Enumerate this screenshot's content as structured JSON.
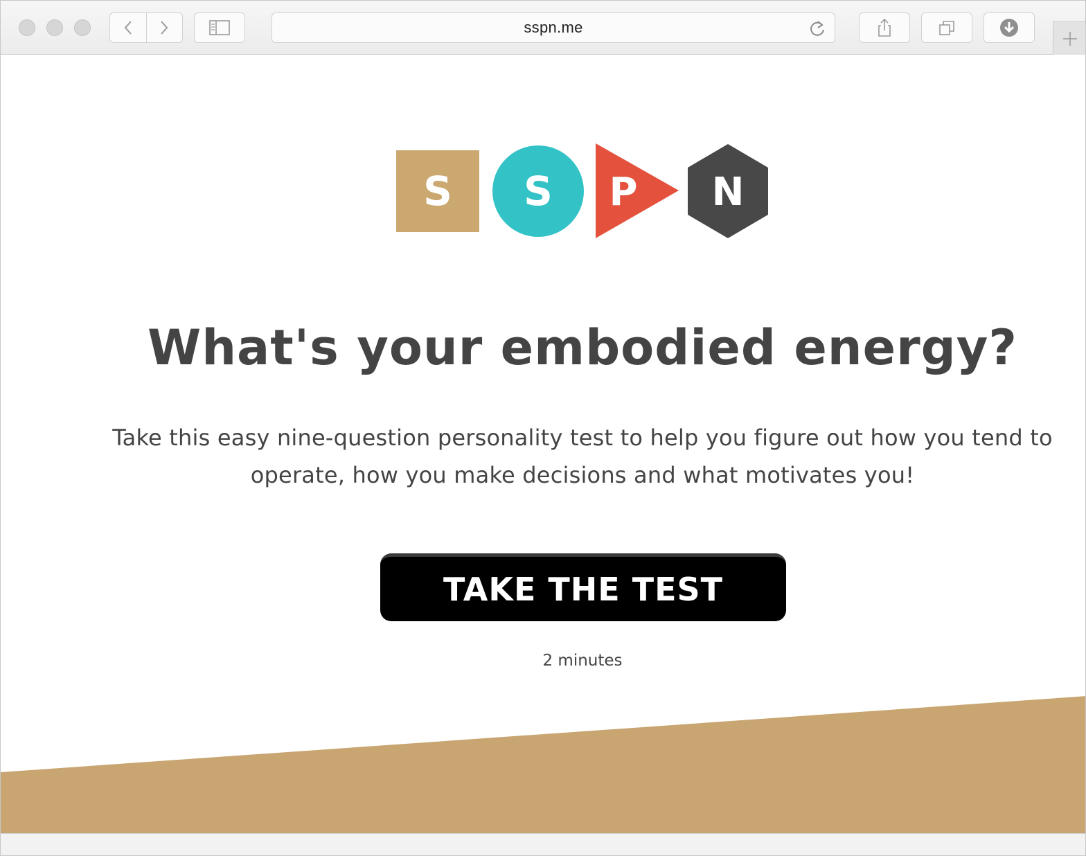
{
  "browser": {
    "address": {
      "url": "sspn.me"
    }
  },
  "logo": {
    "letters": [
      "S",
      "S",
      "P",
      "N"
    ],
    "colors": [
      "#caa870",
      "#33c3c6",
      "#e4513d",
      "#484848"
    ]
  },
  "hero": {
    "headline": "What's your embodied energy?",
    "description": "Take this easy nine-question personality test to help you figure out how you tend to operate, how you make decisions and what motivates you!",
    "cta_label": "TAKE THE TEST",
    "duration": "2 minutes"
  },
  "theme": {
    "band_color": "#c8a571",
    "text_color": "#444444",
    "cta_bg": "#000000"
  }
}
